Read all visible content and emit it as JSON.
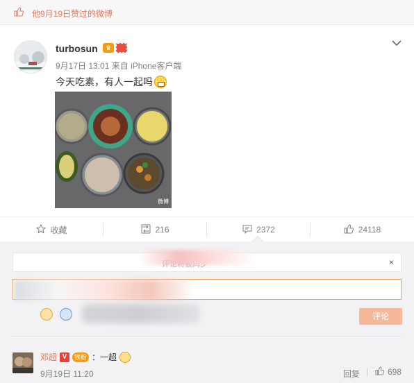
{
  "liked_bar": {
    "text": "他9月19日赞过的微博"
  },
  "post": {
    "username": "turbosun",
    "time": "9月17日 13:01",
    "source_prefix": "来自",
    "source": "iPhone客户端",
    "content": "今天吃素，有人一起吗",
    "photo_watermark": "微博"
  },
  "actions": {
    "favorite": {
      "label": "收藏"
    },
    "repost": {
      "count": "216"
    },
    "comment": {
      "count": "2372"
    },
    "like": {
      "count": "24118"
    }
  },
  "comment_box": {
    "notice_text": "评论将被同步",
    "close": "×",
    "submit_label": "评论"
  },
  "comments": [
    {
      "user": "邓超",
      "fan_badge": "铁粉",
      "text": "：一超",
      "time": "9月19日 11:20",
      "reply_label": "回复",
      "likes": "698"
    }
  ],
  "colors": {
    "accent": "#eb7350",
    "liked_text": "#e07a5f",
    "submit_bg": "#f5b99a",
    "input_border": "#ed9a58",
    "muted": "#808080"
  }
}
